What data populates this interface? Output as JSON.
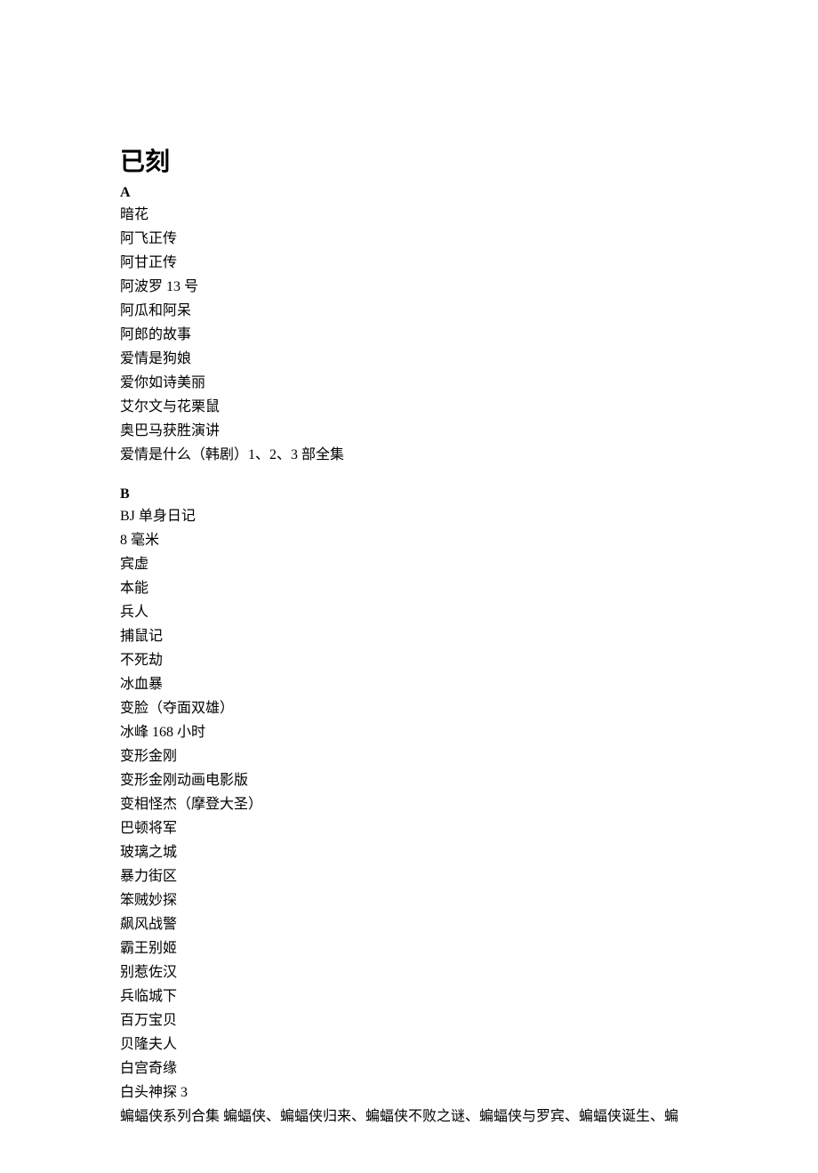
{
  "title": "已刻",
  "sections": [
    {
      "header": "A",
      "items": [
        "暗花",
        "阿飞正传",
        "阿甘正传",
        "阿波罗 13 号",
        "阿瓜和阿呆",
        "阿郎的故事",
        "爱情是狗娘",
        "爱你如诗美丽",
        "艾尔文与花栗鼠",
        "奥巴马获胜演讲",
        "爱情是什么（韩剧）1、2、3 部全集"
      ]
    },
    {
      "header": "B",
      "items": [
        "BJ 单身日记",
        "8 毫米",
        "宾虚",
        "本能",
        "兵人",
        "捕鼠记",
        "不死劫",
        "冰血暴",
        "变脸（夺面双雄）",
        "冰峰 168 小时",
        "变形金刚",
        "变形金刚动画电影版",
        "变相怪杰（摩登大圣）",
        "巴顿将军",
        "玻璃之城",
        "暴力街区",
        "笨贼妙探",
        "飙风战警",
        "霸王别姬",
        "别惹佐汉",
        "兵临城下",
        "百万宝贝",
        "贝隆夫人",
        "白宫奇缘",
        "白头神探 3",
        "蝙蝠侠系列合集 蝙蝠侠、蝙蝠侠归来、蝙蝠侠不败之谜、蝙蝠侠与罗宾、蝙蝠侠诞生、蝙"
      ]
    }
  ]
}
